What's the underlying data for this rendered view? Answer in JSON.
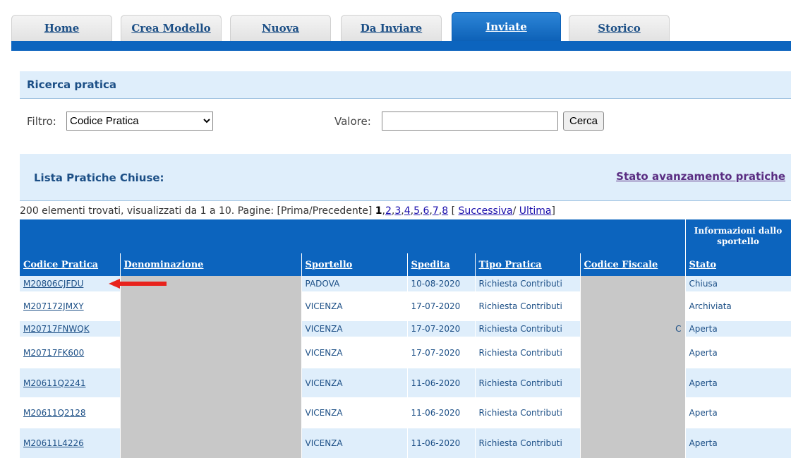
{
  "tabs": [
    {
      "label": "Home"
    },
    {
      "label": "Crea Modello"
    },
    {
      "label": "Nuova"
    },
    {
      "label": "Da Inviare"
    },
    {
      "label": "Inviate"
    },
    {
      "label": "Storico"
    }
  ],
  "search": {
    "title": "Ricerca pratica",
    "filter_label": "Filtro:",
    "filter_value": "Codice Pratica",
    "value_label": "Valore:",
    "value_text": "",
    "button": "Cerca"
  },
  "list": {
    "title": "Lista Pratiche Chiuse:",
    "status_link": "Stato avanzamento pratiche"
  },
  "pager": {
    "summary": "200 elementi trovati, visualizzati da 1 a 10. Pagine: [Prima/Precedente]",
    "current": "1",
    "pages": [
      "2",
      "3",
      "4",
      "5",
      "6",
      "7",
      "8"
    ],
    "open": "[",
    "next": "Successiva",
    "sep": "/",
    "last": "Ultima",
    "close": "]"
  },
  "table": {
    "info_header": "Informazioni dallo sportello",
    "headers": [
      "Codice Pratica",
      "Denominazione",
      "Sportello",
      "Spedita",
      "Tipo Pratica",
      "Codice Fiscale",
      "Stato"
    ],
    "rows": [
      {
        "code": "M20806CJFDU",
        "sportello": "PADOVA",
        "date": "10-08-2020",
        "tipo": "Richiesta Contributi",
        "cf_tail": "",
        "stato": "Chiusa"
      },
      {
        "code": "M207172JMXY",
        "sportello": "VICENZA",
        "date": "17-07-2020",
        "tipo": "Richiesta Contributi",
        "cf_tail": "",
        "stato": "Archiviata"
      },
      {
        "code": "M20717FNWQK",
        "sportello": "VICENZA",
        "date": "17-07-2020",
        "tipo": "Richiesta Contributi",
        "cf_tail": "C",
        "stato": "Aperta"
      },
      {
        "code": "M20717FK600",
        "sportello": "VICENZA",
        "date": "17-07-2020",
        "tipo": "Richiesta Contributi",
        "cf_tail": "",
        "stato": "Aperta"
      },
      {
        "code": "M20611Q2241",
        "sportello": "VICENZA",
        "date": "11-06-2020",
        "tipo": "Richiesta Contributi",
        "cf_tail": "",
        "stato": "Aperta"
      },
      {
        "code": "M20611Q2128",
        "sportello": "VICENZA",
        "date": "11-06-2020",
        "tipo": "Richiesta Contributi",
        "cf_tail": "",
        "stato": "Aperta"
      },
      {
        "code": "M20611L4226",
        "sportello": "VICENZA",
        "date": "11-06-2020",
        "tipo": "Richiesta Contributi",
        "cf_tail": "",
        "stato": "Aperta"
      }
    ]
  },
  "colors": {
    "primary": "#0c64be",
    "light": "#dfeefb",
    "link": "#1c4f86",
    "redacted": "#c8c8c8",
    "arrow": "#e8231c"
  },
  "icons": {
    "annotation": "red-arrow-icon"
  }
}
